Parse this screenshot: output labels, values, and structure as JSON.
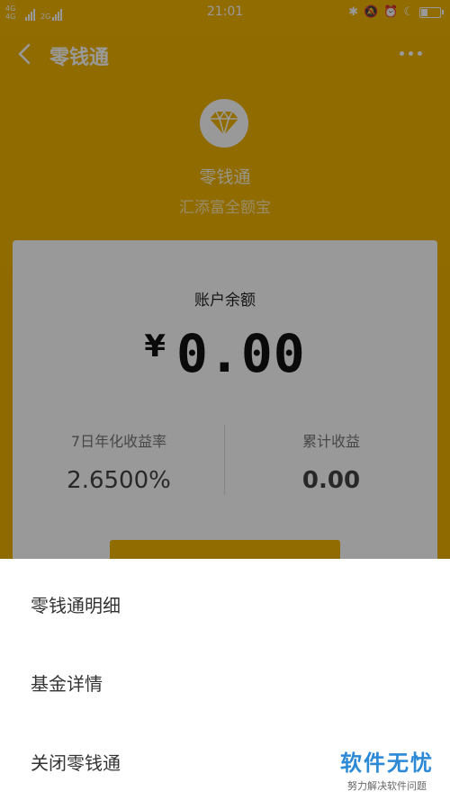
{
  "status_bar": {
    "network_left": "4G 4G",
    "network_right": "2G",
    "time": "21:01"
  },
  "header": {
    "title": "零钱通",
    "back_icon": "chevron-left-icon",
    "more_icon": "more-dots-icon"
  },
  "product": {
    "logo_icon": "diamond-icon",
    "name": "零钱通",
    "subtitle": "汇添富全额宝"
  },
  "card": {
    "balance_label": "账户余额",
    "currency": "¥",
    "balance": "0.00",
    "stats": [
      {
        "label": "7日年化收益率",
        "value": "2.6500%"
      },
      {
        "label": "累计收益",
        "value": "0.00"
      }
    ]
  },
  "action_sheet": {
    "items": [
      {
        "label": "零钱通明细"
      },
      {
        "label": "基金详情"
      },
      {
        "label": "关闭零钱通"
      }
    ]
  },
  "watermark": {
    "title": "软件无忧",
    "subtitle": "努力解决软件问题"
  },
  "colors": {
    "accent": "#f2b500",
    "watermark": "#2c89d6"
  }
}
